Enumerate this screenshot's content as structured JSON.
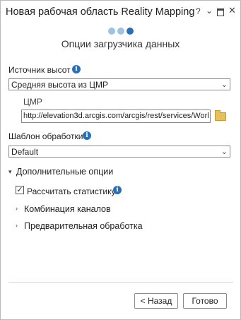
{
  "window": {
    "title": "Новая рабочая область Reality Mapping",
    "help_icon": "?",
    "chevron_icon": "⌄",
    "close_icon": "✕"
  },
  "wizard": {
    "step_current": 3,
    "step_total": 3,
    "page_title": "Опции загрузчика данных"
  },
  "elevation_source": {
    "label": "Источник высот",
    "value": "Средняя высота из ЦМР"
  },
  "dem": {
    "label": "ЦМР",
    "value": "http://elevation3d.arcgis.com/arcgis/rest/services/Worl"
  },
  "processing_template": {
    "label": "Шаблон обработки",
    "value": "Default"
  },
  "advanced_options": {
    "label": "Дополнительные опции",
    "compute_statistics": {
      "label": "Рассчитать статистику",
      "checked": true
    },
    "band_combination": "Комбинация каналов",
    "preprocessing": "Предварительная обработка"
  },
  "buttons": {
    "back": "< Назад",
    "done": "Готово"
  },
  "colors": {
    "accent": "#2a6fb6",
    "step_inactive": "#9bc3e6"
  }
}
